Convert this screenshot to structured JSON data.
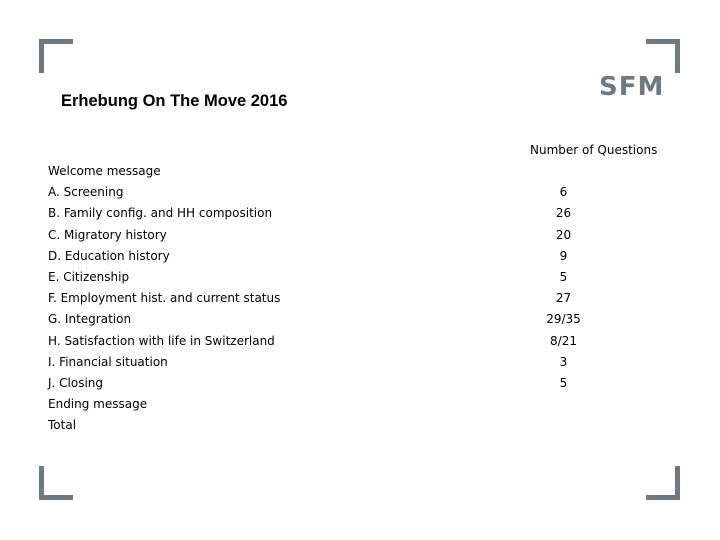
{
  "slide": {
    "title": "Erhebung On The Move 2016",
    "logo_text": "SFM",
    "accent_color": "#6b7a83"
  },
  "table": {
    "column_header": "Number of Questions",
    "rows": [
      {
        "label": "Welcome message",
        "value": ""
      },
      {
        "label": "A. Screening",
        "value": "6"
      },
      {
        "label": "B. Family config. and HH composition",
        "value": "26"
      },
      {
        "label": "C. Migratory history",
        "value": "20"
      },
      {
        "label": "D. Education history",
        "value": "9"
      },
      {
        "label": "E. Citizenship",
        "value": "5"
      },
      {
        "label": "F. Employment hist. and current status",
        "value": "27"
      },
      {
        "label": "G. Integration",
        "value": "29/35"
      },
      {
        "label": "H. Satisfaction with life in Switzerland",
        "value": "8/21"
      },
      {
        "label": "I. Financial situation",
        "value": "3"
      },
      {
        "label": "J. Closing",
        "value": "5"
      },
      {
        "label": "Ending message",
        "value": ""
      },
      {
        "label": "Total",
        "value": ""
      }
    ]
  }
}
